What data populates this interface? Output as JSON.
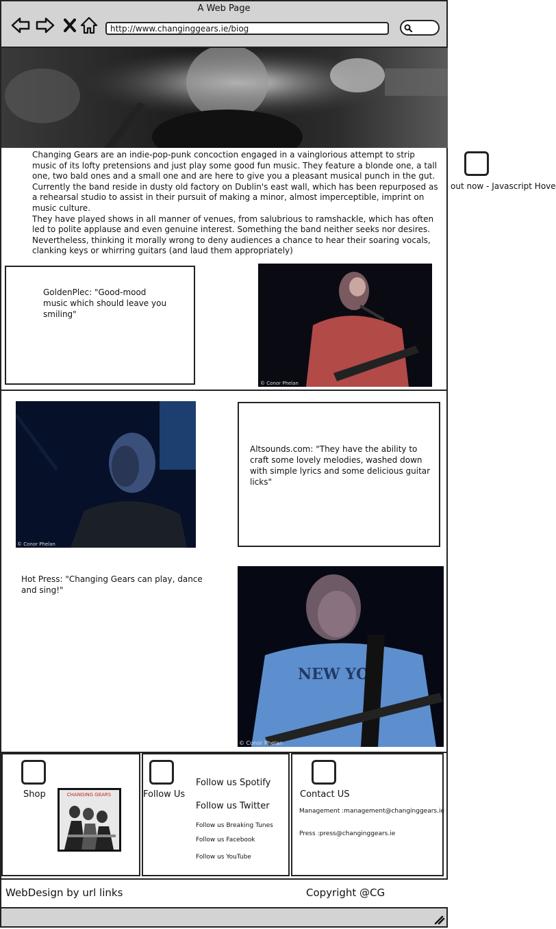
{
  "window": {
    "title": "A Web Page",
    "url": "http://www.changinggears.ie/biog"
  },
  "nav": [
    "back-icon",
    "forward-icon",
    "close-icon",
    "home-icon"
  ],
  "intro": {
    "paragraphs": [
      "Changing Gears are an indie-pop-punk concoction engaged in a vainglorious attempt to strip music of its lofty pretensions and just play some good fun music. They feature a blonde one, a tall one, two bald ones and a small one and are here to give you a pleasant musical punch in the gut.",
      "Currently the band reside in dusty old factory on Dublin's east wall, which has been repurposed as a rehearsal studio to assist in their pursuit of making a minor, almost imperceptible, imprint on music culture.",
      "They have played shows in all manner of venues, from salubrious to ramshackle, which has often led to polite applause and even genuine interest. Something the band neither seeks nor desires. Nevertheless, thinking it morally wrong to deny audiences a chance to hear their soaring vocals, clanking keys or whirring guitars (and laud them appropriately)"
    ]
  },
  "annotation": {
    "text": "out now - Javascript Hover"
  },
  "quotes": {
    "goldenplec": "GoldenPlec: \"Good-mood music which should leave you smiling\"",
    "altsounds": "Altsounds.com: \"They have the ability to craft some lovely melodies, washed down with simple lyrics and some delicious guitar licks\"",
    "hotpress": "Hot Press: \"Changing Gears can play, dance and sing!\""
  },
  "photo_credit": "© Conor Phelan",
  "album_cover_text": "CHANGING GEARS",
  "footer": {
    "shop_label": "Shop",
    "follow_label": "Follow Us",
    "follow_links": {
      "spotify": "Follow us Spotify",
      "twitter": "Follow us Twitter",
      "breaking_tunes": "Follow us Breaking Tunes",
      "facebook": "Follow us Facebook",
      "youtube": "Follow us YouTube"
    },
    "contact_label": "Contact US",
    "management": "Management :management@changinggears.ie",
    "press": "Press :press@changinggears.ie",
    "webdesign": "WebDesign by url links",
    "copyright": "Copyright @CG"
  }
}
